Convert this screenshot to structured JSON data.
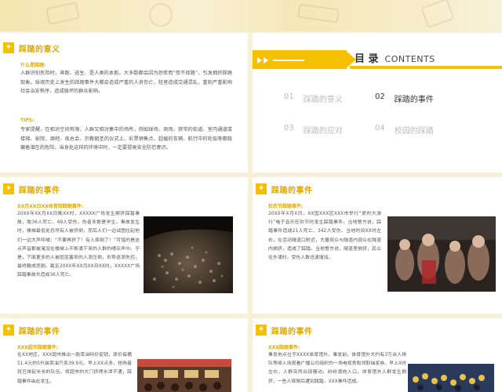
{
  "colors": {
    "accent": "#f5c000",
    "title_yellow": "#e3a800",
    "text": "#555555"
  },
  "slide1": {
    "title": "踩踏的意义",
    "sub1": "什么是踩踏:",
    "para1": "人群识别危险时，奔跑、逃生、是人类的本能。大多数都会因为恐慌而“慌不择路”，引发拥挤踩踏现象。纵观历史上发生的踩踏事件大都会造成严重的人员伤亡，轻者造成交通混乱，重则严重影响社会治安秩序，造成极坏的群众影响。",
    "sub2": "TIPS:",
    "para2": "专家提醒，在相对空间有限，人群又相对集中的场所，例如球场、商场、狭窄的街道、室内通道或楼梯、影院、酒吧、夜总会、宗教朝圣的仪式上、彩票销售点、超载的车辆、航行中的轮船等都隐藏着潜在的危险，当身处这样的环境中时，一定要提高安全防范意识。"
  },
  "toc": {
    "title_cn": "目 录",
    "title_en": "CONTENTS",
    "items": [
      {
        "num": "01",
        "label": "踩踏的意义"
      },
      {
        "num": "02",
        "label": "踩踏的事件"
      },
      {
        "num": "03",
        "label": "踩踏的应对"
      },
      {
        "num": "04",
        "label": "校园的踩踏"
      }
    ]
  },
  "slide3": {
    "title": "踩踏的事件",
    "sub": "XX月XX日XX体育馆踩踏事件:",
    "para": "20XX年XX月XX日晚XX时，XXXXX广场发生拥挤踩踏事故，致36人死亡、49人受伤，伤者多数是学生。事故发生时，楼梯最低处忽然有人被挤倒，而后人们一边试图拉起他们一边大声呼喊：“不要再挤了！有人摔倒了！”可惜的是这点声音都被淹没在楼梯上不断涌下来的人群的嘈杂声中。于是，下面更多的人被层层塞来的人浪压倒，形势逐渐失控，最终酿成悲剧。截至20XX年XX月XX日XX时，XXXXX广场踩踏事故共造成36人死亡。"
  },
  "slide4": {
    "title": "踩踏的事件",
    "sub": "狂欢节踩踏事件:",
    "para": "20XX年X月X日，XX国XXX区XXX市举行“爱的大游行”电子音乐狂欢节时发生踩踏事件，当地警方说，踩踏事件造成21人死亡、342人受伤。当地时间XX时左右，在活动隧道口附近，大量观众与隧道内观众在隧道内拥挤，造成了踩踏。当地警方说，隧道里拥挤，民众往外涌时，受伤人数迅速增加。"
  },
  "slide5": {
    "title": "踩踏的事件",
    "sub": "XXX超市踩踏事件:",
    "para": "在XX地区，XXX超市推出一款菜油特价促销，原价每桶51.4元的5升装菜油只卖39.9元。早上XX点多，抢购者就已排起长长的队伍。将超市的大门挤得水泄不通，踩踏事件由此发生。"
  },
  "slide6": {
    "title": "踩踏的事件",
    "sub": "XXX踩踏事件:",
    "para": "事发地点位于XXXX体育馆外。事发前，体育馆外大约有3万余人排队等候入场观看广播公司组织的一场电视秀和领取抽奖券。早上X时左右，人群突然出现骚动，纷纷涌向入口，体育馆外人群发生拥挤，一些人摔倒后遭到践踏，XXX事件造成。"
  }
}
